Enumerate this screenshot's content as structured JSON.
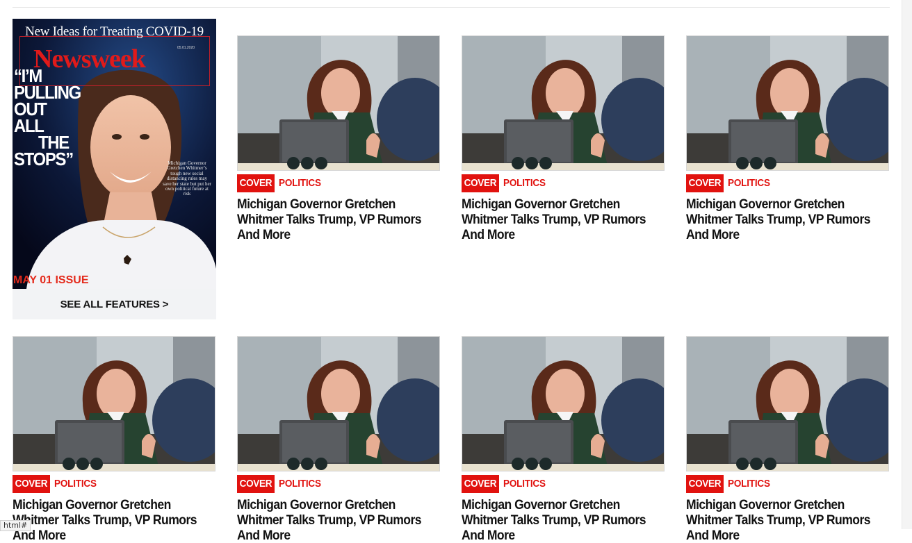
{
  "cover": {
    "masthead": "New Ideas for Treating COVID-19",
    "logo": "Newsweek",
    "date": "05.01.2020",
    "headline_lines": [
      "“I’M",
      "PULLING",
      "OUT",
      "ALL",
      "THE",
      "STOPS”"
    ],
    "blurb": "Michigan Governor Gretchen Whitmer’s tough new social distancing rules may save her state but put her own political future at risk",
    "issue_label": "MAY 01 ISSUE",
    "see_all": "SEE ALL FEATURES >"
  },
  "articles": [
    {
      "tag": "COVER",
      "section": "POLITICS",
      "title": "Michigan Governor Gretchen Whitmer Talks Trump, VP Rumors And More"
    },
    {
      "tag": "COVER",
      "section": "POLITICS",
      "title": "Michigan Governor Gretchen Whitmer Talks Trump, VP Rumors And More"
    },
    {
      "tag": "COVER",
      "section": "POLITICS",
      "title": "Michigan Governor Gretchen Whitmer Talks Trump, VP Rumors And More"
    },
    {
      "tag": "COVER",
      "section": "POLITICS",
      "title": "Michigan Governor Gretchen Whitmer Talks Trump, VP Rumors And More"
    },
    {
      "tag": "COVER",
      "section": "POLITICS",
      "title": "Michigan Governor Gretchen Whitmer Talks Trump, VP Rumors And More"
    },
    {
      "tag": "COVER",
      "section": "POLITICS",
      "title": "Michigan Governor Gretchen Whitmer Talks Trump, VP Rumors And More"
    },
    {
      "tag": "COVER",
      "section": "POLITICS",
      "title": "Michigan Governor Gretchen Whitmer Talks Trump, VP Rumors And More"
    }
  ],
  "status_bar": "html#",
  "colors": {
    "accent": "#e1120f",
    "cover_bg": "#0b1630",
    "panel": "#f2f3f5"
  }
}
